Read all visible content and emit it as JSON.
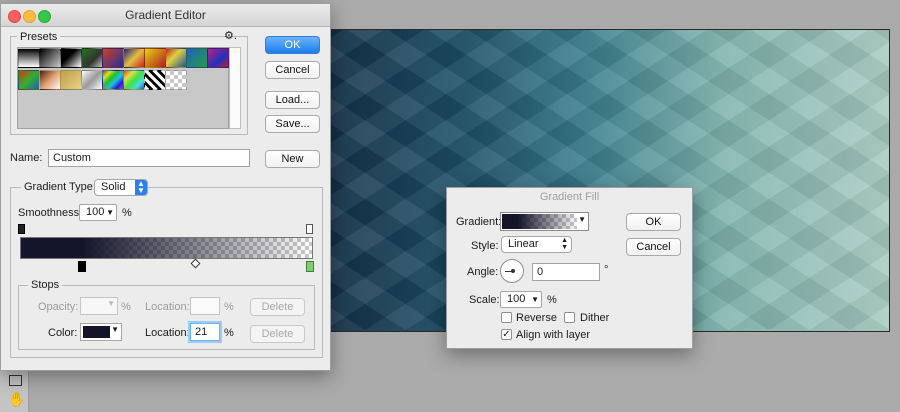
{
  "gradient_editor": {
    "title": "Gradient Editor",
    "presets_label": "Presets",
    "buttons": {
      "ok": "OK",
      "cancel": "Cancel",
      "load": "Load...",
      "save": "Save...",
      "new": "New"
    },
    "name_label": "Name:",
    "name_value": "Custom",
    "gradient_type_label": "Gradient Type:",
    "gradient_type_value": "Solid",
    "smoothness_label": "Smoothness:",
    "smoothness_value": "100",
    "percent": "%",
    "stops": {
      "label": "Stops",
      "opacity_label": "Opacity:",
      "location_label": "Location:",
      "delete_label": "Delete",
      "color_label": "Color:",
      "color_value": "#14142a",
      "color_location_value": "21"
    },
    "preset_swatches": [
      [
        "linear-gradient(#000,#fff)",
        "linear-gradient(135deg,#000,transparent)",
        "linear-gradient(135deg,#000 0%,#000 40%,#fff 100%)",
        "linear-gradient(135deg,#1a7a1a,#333 60%,#c0c0c0)",
        "linear-gradient(135deg,#d04020,#2030a0)",
        "linear-gradient(135deg,#202080,#e0c040 50%,#d02020)",
        "linear-gradient(135deg,#e8d010,#b02020)",
        "linear-gradient(135deg,#c02020,#e0d040 40%,#2050a0)",
        "linear-gradient(135deg,#2060c0,#20a040)",
        "linear-gradient(135deg,#c02080,#2030c0 60%,#c02020)"
      ],
      [
        "linear-gradient(135deg,#e03010,#30b030 50%,#2060c0)",
        "linear-gradient(135deg,#502010,#e0a070 50%,#fff)",
        "linear-gradient(135deg,#c0a040,#e8d090)",
        "linear-gradient(135deg,#fff,#999 50%,#fff)",
        "linear-gradient(135deg,#e02020,#e0e020,#20c020,#20c0e0,#2020e0,#e020e0)",
        "linear-gradient(135deg,#e04040,#e0e040,#40e040,#40e0e0,#4040e0)",
        "repeating-linear-gradient(45deg,#fff 0 3px,#000 3px 6px)",
        "checker"
      ]
    ]
  },
  "gradient_fill": {
    "title": "Gradient Fill",
    "gradient_label": "Gradient:",
    "style_label": "Style:",
    "style_value": "Linear",
    "angle_label": "Angle:",
    "angle_value": "0",
    "degree": "°",
    "scale_label": "Scale:",
    "scale_value": "100",
    "percent": "%",
    "reverse_label": "Reverse",
    "dither_label": "Dither",
    "align_label": "Align with layer",
    "reverse_checked": false,
    "dither_checked": false,
    "align_checked": true,
    "buttons": {
      "ok": "OK",
      "cancel": "Cancel"
    }
  },
  "colors": {
    "accent_button": "#1a7dee",
    "stop_color": "#14142a"
  }
}
